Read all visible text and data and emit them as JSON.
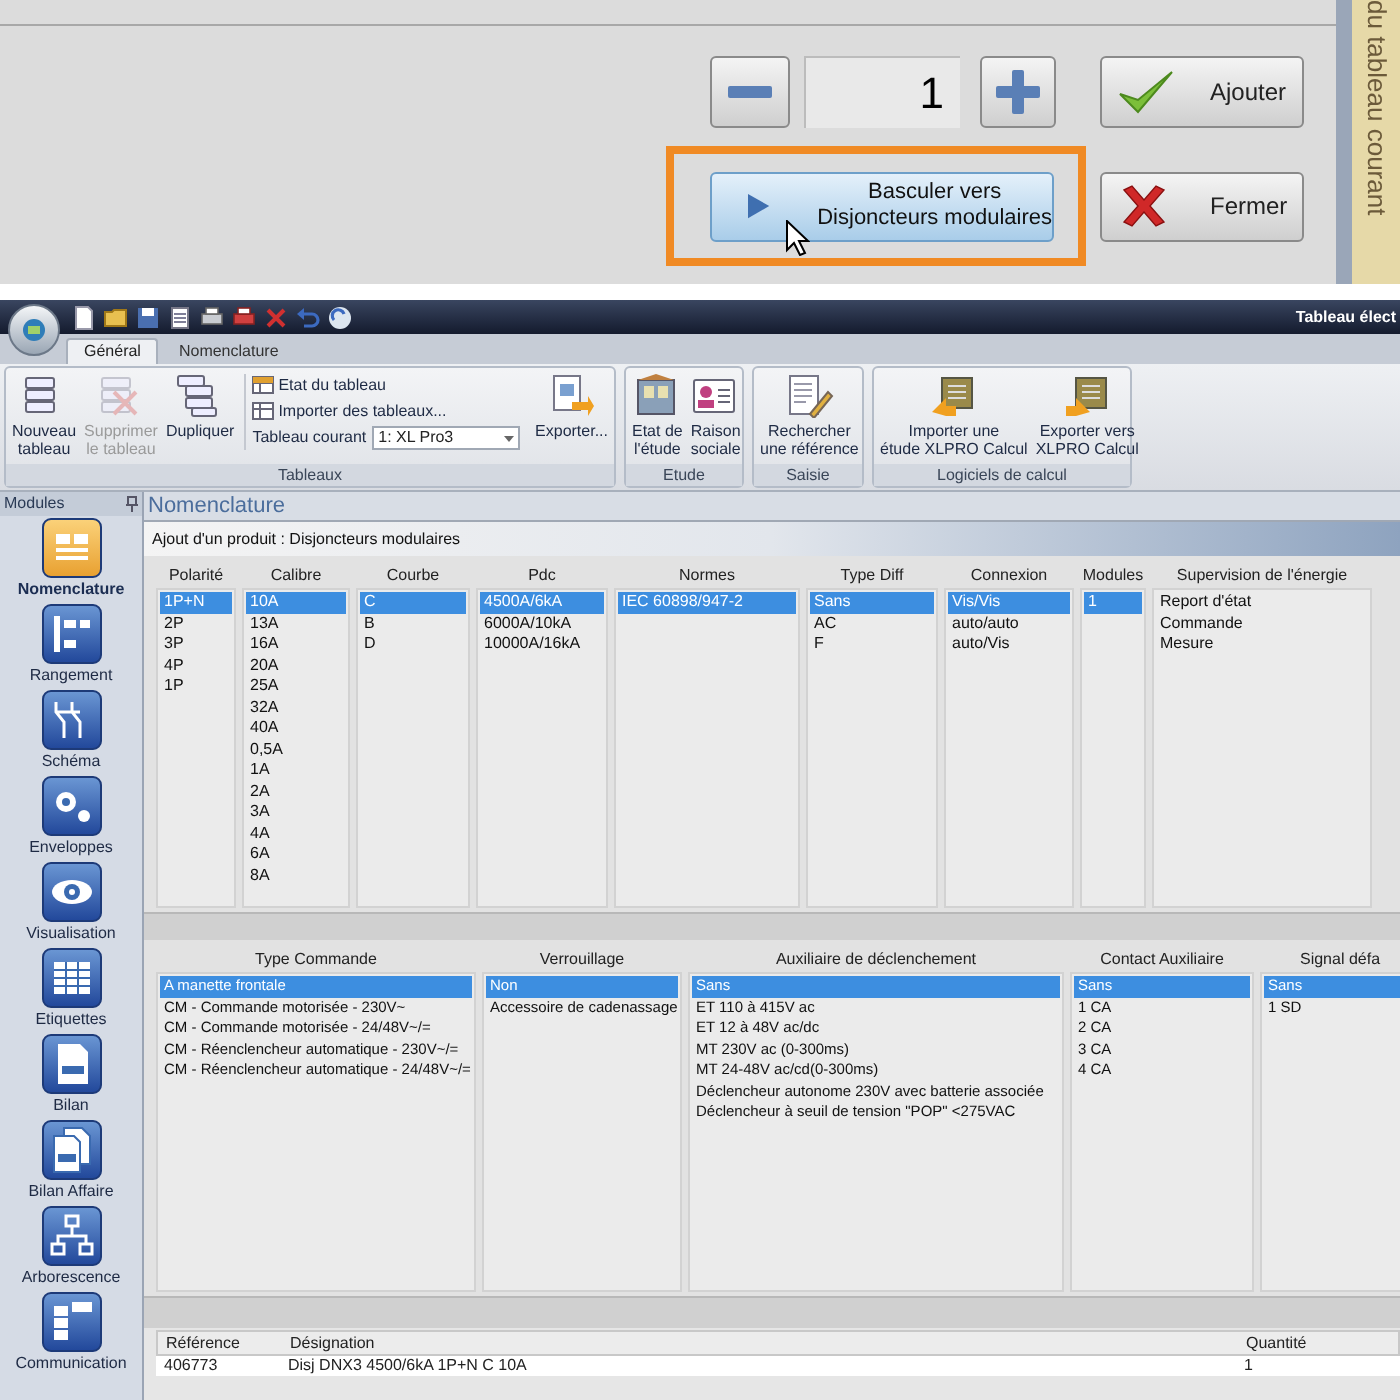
{
  "dialog": {
    "side_tab": "du tableau courant",
    "quantity": "1",
    "add_button": "Ajouter",
    "switch_button": {
      "lines": [
        "Basculer vers",
        "Disjoncteurs modulaires"
      ],
      "highlighted": true
    },
    "close_button": "Fermer"
  },
  "window": {
    "title": "Tableau élect"
  },
  "ribbon_tabs": [
    {
      "label": "Général",
      "selected": true
    },
    {
      "label": "Nomenclature",
      "selected": false
    }
  ],
  "ribbon_groups": [
    {
      "label": "Tableaux",
      "items": [
        {
          "kind": "large",
          "lines": [
            "Nouveau",
            "tableau"
          ],
          "disabled": false
        },
        {
          "kind": "large",
          "lines": [
            "Supprimer",
            "le tableau"
          ],
          "disabled": true
        },
        {
          "kind": "large",
          "lines": [
            "Dupliquer"
          ],
          "disabled": false
        },
        {
          "kind": "stack",
          "rows": [
            {
              "kind": "small",
              "label": "Etat du tableau"
            },
            {
              "kind": "small",
              "label": "Importer des tableaux..."
            },
            {
              "kind": "combo",
              "label": "Tableau courant",
              "value": "1: XL Pro3"
            }
          ]
        },
        {
          "kind": "large",
          "lines": [
            "Exporter..."
          ],
          "disabled": false
        }
      ]
    },
    {
      "label": "Etude",
      "items": [
        {
          "kind": "large",
          "lines": [
            "Etat de",
            "l'étude"
          ],
          "disabled": false
        },
        {
          "kind": "large",
          "lines": [
            "Raison",
            "sociale"
          ],
          "disabled": false
        }
      ]
    },
    {
      "label": "Saisie",
      "items": [
        {
          "kind": "large",
          "lines": [
            "Rechercher",
            "une référence"
          ],
          "disabled": false
        }
      ]
    },
    {
      "label": "Logiciels de calcul",
      "items": [
        {
          "kind": "large",
          "lines": [
            "Importer une",
            "étude XLPRO Calcul"
          ],
          "disabled": false
        },
        {
          "kind": "large",
          "lines": [
            "Exporter vers",
            "XLPRO Calcul"
          ],
          "disabled": false
        }
      ]
    }
  ],
  "modules": {
    "title": "Modules",
    "items": [
      {
        "label": "Nomenclature",
        "selected": true
      },
      {
        "label": "Rangement",
        "selected": false
      },
      {
        "label": "Schéma",
        "selected": false
      },
      {
        "label": "Enveloppes",
        "selected": false
      },
      {
        "label": "Visualisation",
        "selected": false
      },
      {
        "label": "Etiquettes",
        "selected": false
      },
      {
        "label": "Bilan",
        "selected": false
      },
      {
        "label": "Bilan Affaire",
        "selected": false
      },
      {
        "label": "Arborescence",
        "selected": false
      },
      {
        "label": "Communication",
        "selected": false
      }
    ]
  },
  "nomenclature": {
    "title": "Nomenclature",
    "panel_title": "Ajout d'un produit : Disjoncteurs modulaires",
    "upper_lists": [
      {
        "header": "Polarité",
        "items": [
          {
            "label": "1P+N",
            "selected": true
          },
          {
            "label": "2P",
            "selected": false
          },
          {
            "label": "3P",
            "selected": false
          },
          {
            "label": "4P",
            "selected": false
          },
          {
            "label": "1P",
            "selected": false
          }
        ]
      },
      {
        "header": "Calibre",
        "items": [
          {
            "label": "10A",
            "selected": true
          },
          {
            "label": "13A",
            "selected": false
          },
          {
            "label": "16A",
            "selected": false
          },
          {
            "label": "20A",
            "selected": false
          },
          {
            "label": "25A",
            "selected": false
          },
          {
            "label": "32A",
            "selected": false
          },
          {
            "label": "40A",
            "selected": false
          },
          {
            "label": "0,5A",
            "selected": false
          },
          {
            "label": "1A",
            "selected": false
          },
          {
            "label": "2A",
            "selected": false
          },
          {
            "label": "3A",
            "selected": false
          },
          {
            "label": "4A",
            "selected": false
          },
          {
            "label": "6A",
            "selected": false
          },
          {
            "label": "8A",
            "selected": false
          }
        ]
      },
      {
        "header": "Courbe",
        "items": [
          {
            "label": "C",
            "selected": true
          },
          {
            "label": "B",
            "selected": false
          },
          {
            "label": "D",
            "selected": false
          }
        ]
      },
      {
        "header": "Pdc",
        "items": [
          {
            "label": "4500A/6kA",
            "selected": true
          },
          {
            "label": "6000A/10kA",
            "selected": false
          },
          {
            "label": "10000A/16kA",
            "selected": false
          }
        ]
      },
      {
        "header": "Normes",
        "items": [
          {
            "label": "IEC 60898/947-2",
            "selected": true
          }
        ]
      },
      {
        "header": "Type Diff",
        "items": [
          {
            "label": "Sans",
            "selected": true
          },
          {
            "label": "AC",
            "selected": false
          },
          {
            "label": "F",
            "selected": false
          }
        ]
      },
      {
        "header": "Connexion",
        "items": [
          {
            "label": "Vis/Vis",
            "selected": true
          },
          {
            "label": "auto/auto",
            "selected": false
          },
          {
            "label": "auto/Vis",
            "selected": false
          }
        ]
      },
      {
        "header": "Modules",
        "items": [
          {
            "label": "1",
            "selected": true
          }
        ]
      },
      {
        "header": "Supervision de l'énergie",
        "items": [
          {
            "label": "Report d'état",
            "selected": false
          },
          {
            "label": "Commande",
            "selected": false
          },
          {
            "label": "Mesure",
            "selected": false
          }
        ]
      }
    ],
    "lower_lists": [
      {
        "header": "Type Commande",
        "items": [
          {
            "label": "A manette frontale",
            "selected": true
          },
          {
            "label": "CM - Commande motorisée - 230V~",
            "selected": false
          },
          {
            "label": "CM - Commande motorisée - 24/48V~/=",
            "selected": false
          },
          {
            "label": "CM - Réenclencheur automatique - 230V~/=",
            "selected": false
          },
          {
            "label": "CM - Réenclencheur automatique - 24/48V~/=",
            "selected": false
          }
        ]
      },
      {
        "header": "Verrouillage",
        "items": [
          {
            "label": "Non",
            "selected": true
          },
          {
            "label": "Accessoire de cadenassage",
            "selected": false
          }
        ]
      },
      {
        "header": "Auxiliaire de déclenchement",
        "items": [
          {
            "label": "Sans",
            "selected": true
          },
          {
            "label": "ET 110 à 415V ac",
            "selected": false
          },
          {
            "label": "ET 12 à 48V ac/dc",
            "selected": false
          },
          {
            "label": "MT 230V ac (0-300ms)",
            "selected": false
          },
          {
            "label": "MT 24-48V ac/cd(0-300ms)",
            "selected": false
          },
          {
            "label": "Déclencheur autonome 230V avec batterie associée",
            "selected": false
          },
          {
            "label": "Déclencheur à seuil de tension \"POP\" <275VAC",
            "selected": false
          }
        ]
      },
      {
        "header": "Contact Auxiliaire",
        "items": [
          {
            "label": "Sans",
            "selected": true
          },
          {
            "label": "1 CA",
            "selected": false
          },
          {
            "label": "2 CA",
            "selected": false
          },
          {
            "label": "3 CA",
            "selected": false
          },
          {
            "label": "4 CA",
            "selected": false
          }
        ]
      },
      {
        "header": "Signal défa",
        "items": [
          {
            "label": "Sans",
            "selected": true
          },
          {
            "label": "1 SD",
            "selected": false
          }
        ]
      }
    ],
    "table": {
      "columns": [
        "Référence",
        "Désignation",
        "Quantité"
      ],
      "rows": [
        [
          "406773",
          "Disj DNX3 4500/6kA 1P+N C 10A",
          "1"
        ]
      ]
    }
  }
}
